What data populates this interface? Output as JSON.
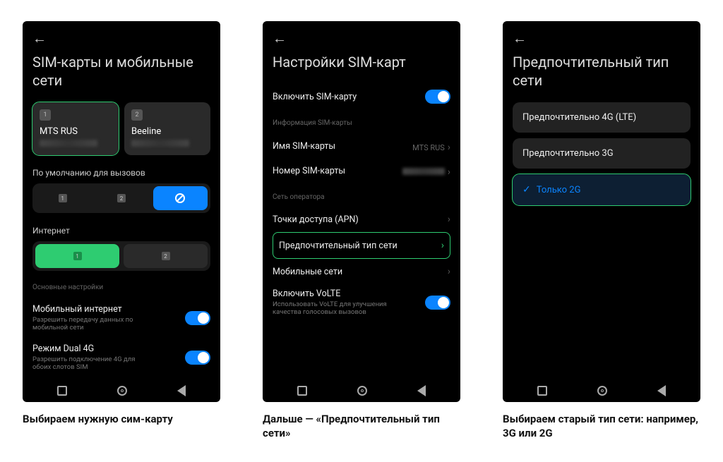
{
  "screen1": {
    "title": "SIM-карты и мобильные сети",
    "sim1": {
      "badge": "1",
      "name": "MTS RUS"
    },
    "sim2": {
      "badge": "2",
      "name": "Beeline"
    },
    "calls_label": "По умолчанию для вызовов",
    "seg_calls": {
      "a": "1",
      "b": "2"
    },
    "internet_label": "Интернет",
    "seg_net": {
      "a": "1",
      "b": "2"
    },
    "main_header": "Основные настройки",
    "mobile_data": {
      "title": "Мобильный интернет",
      "desc": "Разрешить передачу данных по мобильной сети"
    },
    "dual4g": {
      "title": "Режим Dual 4G",
      "desc": "Разрешить подключение 4G для обоих слотов SIM"
    }
  },
  "screen2": {
    "title": "Настройки SIM-карт",
    "enable_sim": "Включить SIM-карту",
    "info_header": "Информация SIM-карты",
    "sim_name": {
      "label": "Имя SIM-карты",
      "value": "MTS RUS"
    },
    "sim_number_label": "Номер SIM-карты",
    "net_header": "Сеть оператора",
    "apn": "Точки доступа (APN)",
    "pref_net": "Предпочтительный тип сети",
    "mobile_nets": "Мобильные сети",
    "volte": {
      "title": "Включить VoLTE",
      "desc": "Использовать VoLTE для улучшения качества голосовых вызовов"
    }
  },
  "screen3": {
    "title": "Предпочтительный тип сети",
    "opt1": "Предпочтительно 4G (LTE)",
    "opt2": "Предпочтительно 3G",
    "opt3": "Только 2G"
  },
  "captions": {
    "c1": "Выбираем нужную сим-карту",
    "c2": "Дальше — «Предпочтительный тип сети»",
    "c3": "Выбираем старый тип сети: например, 3G или 2G"
  }
}
